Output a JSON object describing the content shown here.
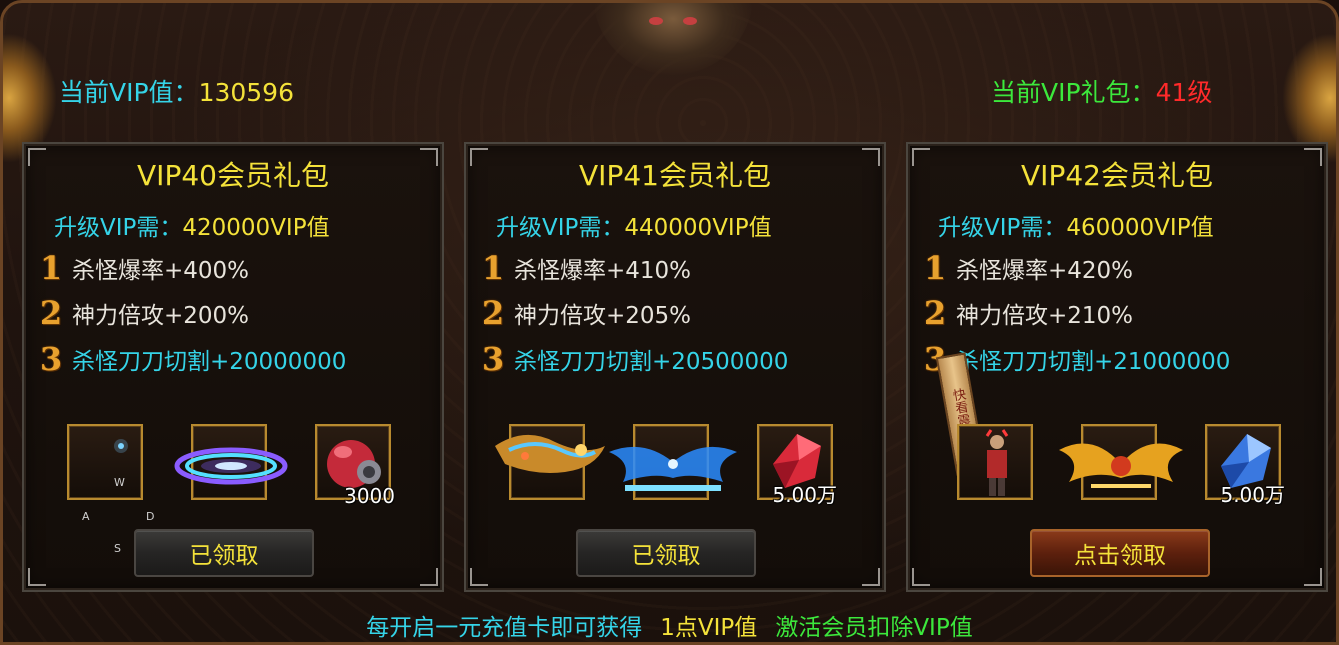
{
  "header": {
    "vip_value_label": "当前VIP值：",
    "vip_value": "130596",
    "vip_gift_label": "当前VIP礼包：",
    "vip_gift_level": "41级"
  },
  "panels": [
    {
      "title": "VIP40会员礼包",
      "req_label": "升级VIP需：",
      "req_value": "420000VIP值",
      "bonuses": [
        {
          "num": "1",
          "text": "杀怪爆率+400%"
        },
        {
          "num": "2",
          "text": "神力倍攻+200%"
        },
        {
          "num": "3",
          "text": "杀怪刀刀切割+20000000"
        }
      ],
      "slots": [
        {
          "icon": "blue-sparkle-icon",
          "qty": ""
        },
        {
          "icon": "rainbow-wing-icon",
          "qty": ""
        },
        {
          "icon": "red-orb-icon",
          "qty": "3000"
        }
      ],
      "button": "已领取",
      "keys": [
        "W",
        "A",
        "D",
        "S"
      ]
    },
    {
      "title": "VIP41会员礼包",
      "req_label": "升级VIP需：",
      "req_value": "440000VIP值",
      "bonuses": [
        {
          "num": "1",
          "text": "杀怪爆率+410%"
        },
        {
          "num": "2",
          "text": "神力倍攻+205%"
        },
        {
          "num": "3",
          "text": "杀怪刀刀切割+20500000"
        }
      ],
      "slots": [
        {
          "icon": "golden-dragon-mount-icon",
          "qty": ""
        },
        {
          "icon": "blue-wing-title-icon",
          "qty": ""
        },
        {
          "icon": "red-crystal-icon",
          "qty": "5.00万"
        }
      ],
      "button": "已领取"
    },
    {
      "title": "VIP42会员礼包",
      "req_label": "升级VIP需：",
      "req_value": "460000VIP值",
      "bonuses": [
        {
          "num": "1",
          "text": "杀怪爆率+420%"
        },
        {
          "num": "2",
          "text": "神力倍攻+210%"
        },
        {
          "num": "3",
          "text": "杀怪刀刀切割+21000000"
        }
      ],
      "slots": [
        {
          "icon": "warrior-figure-icon",
          "qty": ""
        },
        {
          "icon": "golden-phoenix-wing-icon",
          "qty": ""
        },
        {
          "icon": "blue-crystal-icon",
          "qty": "5.00万"
        }
      ],
      "button": "点击领取",
      "scroll_text": "快看震撼"
    }
  ],
  "footer": {
    "part1": "每开启一元充值卡即可获得",
    "part2": "1点VIP值",
    "part3": "激活会员扣除VIP值"
  },
  "colors": {
    "cyan": "#35d4e8",
    "yellow": "#f4e23a",
    "green": "#3ce83c",
    "red": "#ff2a2a",
    "gold_border": "#b88a2f"
  }
}
